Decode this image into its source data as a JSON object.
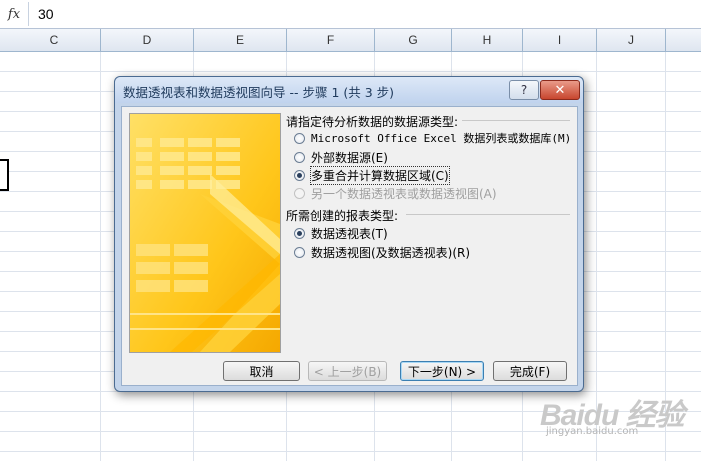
{
  "formula_bar": {
    "fx_label": "fx",
    "value": "30"
  },
  "columns": [
    "C",
    "D",
    "E",
    "F",
    "G",
    "H",
    "I",
    "J"
  ],
  "dialog": {
    "title": "数据透视表和数据透视图向导 -- 步骤 1 (共 3 步)",
    "help_label": "?",
    "close_label": "✕",
    "source_heading": "请指定待分析数据的数据源类型:",
    "source_options": [
      {
        "label": "Microsoft Office Excel 数据列表或数据库(M)",
        "checked": false,
        "disabled": false
      },
      {
        "label": "外部数据源(E)",
        "checked": false,
        "disabled": false
      },
      {
        "label": "多重合并计算数据区域(C)",
        "checked": true,
        "disabled": false
      },
      {
        "label": "另一个数据透视表或数据透视图(A)",
        "checked": false,
        "disabled": true
      }
    ],
    "report_heading": "所需创建的报表类型:",
    "report_options": [
      {
        "label": "数据透视表(T)",
        "checked": true
      },
      {
        "label": "数据透视图(及数据透视表)(R)",
        "checked": false
      }
    ],
    "buttons": {
      "cancel": "取消",
      "back": "< 上一步(B)",
      "next": "下一步(N) >",
      "finish": "完成(F)"
    }
  },
  "watermark": {
    "brand": "Baidu 经验",
    "url": "jingyan.baidu.com"
  },
  "colors": {
    "accent_yellow": "#ffc107",
    "dialog_frame": "#c3d4ea",
    "selected_column": "#f7b651"
  }
}
